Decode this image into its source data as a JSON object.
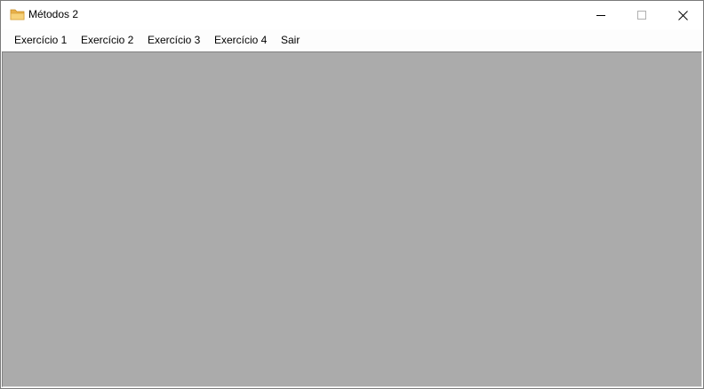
{
  "window": {
    "title": "Métodos 2",
    "icon": "folder-icon",
    "controls": {
      "minimize": "minimize-icon",
      "maximize": "maximize-icon",
      "close": "close-icon"
    }
  },
  "menu": {
    "items": [
      {
        "label": "Exercício 1"
      },
      {
        "label": "Exercício 2"
      },
      {
        "label": "Exercício 3"
      },
      {
        "label": "Exercício 4"
      },
      {
        "label": "Sair"
      }
    ]
  },
  "colors": {
    "mdi_background": "#ababab",
    "titlebar": "#ffffff",
    "menubar": "#fdfdfd",
    "folder_icon": "#f4c55c"
  }
}
